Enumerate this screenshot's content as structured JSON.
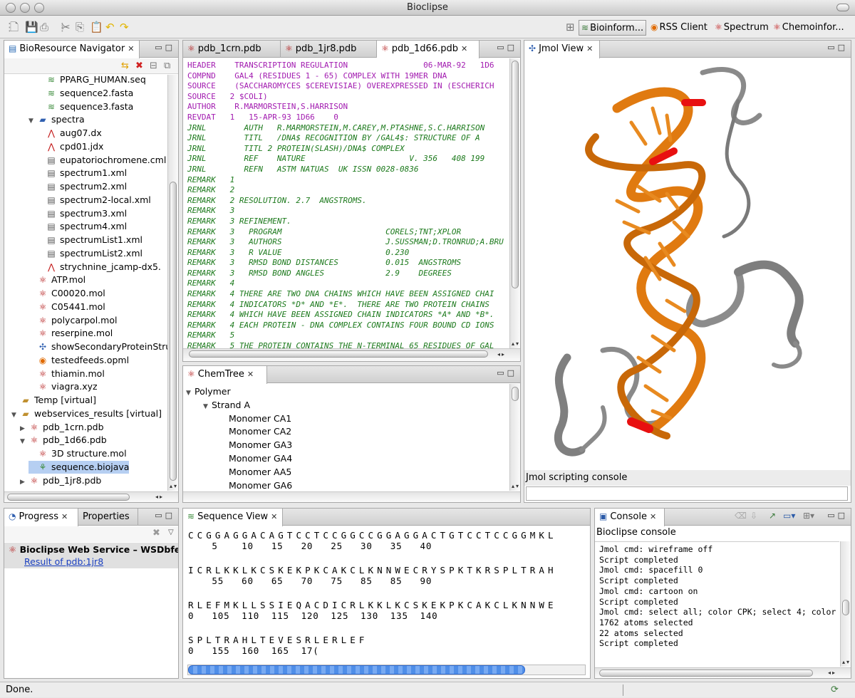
{
  "window": {
    "title": "Bioclipse"
  },
  "perspectives": [
    {
      "label": "Bioinform...",
      "icon": "bioinformatics-icon",
      "active": true
    },
    {
      "label": "RSS Client",
      "icon": "rss-icon"
    },
    {
      "label": "Spectrum",
      "icon": "spectrum-icon"
    },
    {
      "label": "Chemoinfor...",
      "icon": "chemoinformatics-icon"
    }
  ],
  "navigator": {
    "title": "BioResource Navigator",
    "items": [
      {
        "label": "PPARG_HUMAN.seq",
        "indent": 4,
        "icon": "sequence-icon"
      },
      {
        "label": "sequence2.fasta",
        "indent": 4,
        "icon": "sequence-icon"
      },
      {
        "label": "sequence3.fasta",
        "indent": 4,
        "icon": "sequence-icon"
      },
      {
        "label": "spectra",
        "indent": 3,
        "icon": "folder-icon",
        "twisty": "open"
      },
      {
        "label": "aug07.dx",
        "indent": 4,
        "icon": "spectrum-file-icon"
      },
      {
        "label": "cpd01.jdx",
        "indent": 4,
        "icon": "spectrum-file-icon"
      },
      {
        "label": "eupatoriochromene.cml",
        "indent": 4,
        "icon": "cml-file-icon"
      },
      {
        "label": "spectrum1.xml",
        "indent": 4,
        "icon": "xml-file-icon"
      },
      {
        "label": "spectrum2.xml",
        "indent": 4,
        "icon": "xml-file-icon"
      },
      {
        "label": "spectrum2-local.xml",
        "indent": 4,
        "icon": "xml-file-icon"
      },
      {
        "label": "spectrum3.xml",
        "indent": 4,
        "icon": "xml-file-icon"
      },
      {
        "label": "spectrum4.xml",
        "indent": 4,
        "icon": "xml-file-icon"
      },
      {
        "label": "spectrumList1.xml",
        "indent": 4,
        "icon": "xml-file-icon"
      },
      {
        "label": "spectrumList2.xml",
        "indent": 4,
        "icon": "xml-file-icon"
      },
      {
        "label": "strychnine_jcamp-dx5.",
        "indent": 4,
        "icon": "spectrum-file-icon"
      },
      {
        "label": "ATP.mol",
        "indent": 3,
        "icon": "molecule-icon"
      },
      {
        "label": "C00020.mol",
        "indent": 3,
        "icon": "molecule-icon"
      },
      {
        "label": "C05441.mol",
        "indent": 3,
        "icon": "molecule-icon"
      },
      {
        "label": "polycarpol.mol",
        "indent": 3,
        "icon": "molecule-icon"
      },
      {
        "label": "reserpine.mol",
        "indent": 3,
        "icon": "molecule-icon"
      },
      {
        "label": "showSecondaryProteinStruct",
        "indent": 3,
        "icon": "script-icon"
      },
      {
        "label": "testedfeeds.opml",
        "indent": 3,
        "icon": "feed-icon"
      },
      {
        "label": "thiamin.mol",
        "indent": 3,
        "icon": "molecule-icon"
      },
      {
        "label": "viagra.xyz",
        "indent": 3,
        "icon": "molecule-icon"
      },
      {
        "label": "Temp [virtual]",
        "indent": 1,
        "icon": "virtual-folder-icon"
      },
      {
        "label": "webservices_results [virtual]",
        "indent": 1,
        "icon": "virtual-folder-icon",
        "twisty": "open"
      },
      {
        "label": "pdb_1crn.pdb",
        "indent": 2,
        "icon": "pdb-icon",
        "twisty": "closed"
      },
      {
        "label": "pdb_1d66.pdb",
        "indent": 2,
        "icon": "pdb-icon",
        "twisty": "open"
      },
      {
        "label": "3D structure.mol",
        "indent": 3,
        "icon": "molecule-icon"
      },
      {
        "label": "sequence.biojava",
        "indent": 3,
        "icon": "biojava-icon",
        "selected": true
      },
      {
        "label": "pdb_1jr8.pdb",
        "indent": 2,
        "icon": "pdb-icon",
        "twisty": "closed"
      }
    ]
  },
  "editor": {
    "tabs": [
      {
        "label": "pdb_1crn.pdb"
      },
      {
        "label": "pdb_1jr8.pdb"
      },
      {
        "label": "pdb_1d66.pdb",
        "active": true
      }
    ],
    "lines": [
      {
        "t": "HEADER    TRANSCRIPTION REGULATION                06-MAR-92   1D6",
        "c": "mag"
      },
      {
        "t": "COMPND    GAL4 (RESIDUES 1 - 65) COMPLEX WITH 19MER DNA",
        "c": "mag"
      },
      {
        "t": "SOURCE    (SACCHAROMYCES $CEREVISIAE) OVEREXPRESSED IN (ESCHERICH",
        "c": "mag"
      },
      {
        "t": "SOURCE   2 $COLI)",
        "c": "mag"
      },
      {
        "t": "AUTHOR    R.MARMORSTEIN,S.HARRISON",
        "c": "mag"
      },
      {
        "t": "REVDAT   1   15-APR-93 1D66    0",
        "c": "mag"
      },
      {
        "t": "JRNL        AUTH   R.MARMORSTEIN,M.CAREY,M.PTASHNE,S.C.HARRISON",
        "c": "grn"
      },
      {
        "t": "JRNL        TITL   /DNA$ RECOGNITION BY /GAL4$: STRUCTURE OF A",
        "c": "grn"
      },
      {
        "t": "JRNL        TITL 2 PROTEIN(SLASH)/DNA$ COMPLEX",
        "c": "grn"
      },
      {
        "t": "JRNL        REF    NATURE                      V. 356   408 199",
        "c": "grn"
      },
      {
        "t": "JRNL        REFN   ASTM NATUAS  UK ISSN 0028-0836",
        "c": "grn"
      },
      {
        "t": "REMARK   1",
        "c": "grn"
      },
      {
        "t": "REMARK   2",
        "c": "grn"
      },
      {
        "t": "REMARK   2 RESOLUTION. 2.7  ANGSTROMS.",
        "c": "grn"
      },
      {
        "t": "REMARK   3",
        "c": "grn"
      },
      {
        "t": "REMARK   3 REFINEMENT.",
        "c": "grn"
      },
      {
        "t": "REMARK   3   PROGRAM                      CORELS;TNT;XPLOR",
        "c": "grn"
      },
      {
        "t": "REMARK   3   AUTHORS                      J.SUSSMAN;D.TRONRUD;A.BRU",
        "c": "grn"
      },
      {
        "t": "REMARK   3   R VALUE                      0.230",
        "c": "grn"
      },
      {
        "t": "REMARK   3   RMSD BOND DISTANCES          0.015  ANGSTROMS",
        "c": "grn"
      },
      {
        "t": "REMARK   3   RMSD BOND ANGLES             2.9    DEGREES",
        "c": "grn"
      },
      {
        "t": "REMARK   4",
        "c": "grn"
      },
      {
        "t": "REMARK   4 THERE ARE TWO DNA CHAINS WHICH HAVE BEEN ASSIGNED CHAI",
        "c": "grn"
      },
      {
        "t": "REMARK   4 INDICATORS *D* AND *E*.  THERE ARE TWO PROTEIN CHAINS",
        "c": "grn"
      },
      {
        "t": "REMARK   4 WHICH HAVE BEEN ASSIGNED CHAIN INDICATORS *A* AND *B*.",
        "c": "grn"
      },
      {
        "t": "REMARK   4 EACH PROTEIN - DNA COMPLEX CONTAINS FOUR BOUND CD IONS",
        "c": "grn"
      },
      {
        "t": "REMARK   5",
        "c": "grn"
      },
      {
        "t": "REMARK   5 THE PROTEIN CONTAINS THE N-TERMINAL 65 RESIDUES OF GAL",
        "c": "grn"
      }
    ]
  },
  "chemtree": {
    "title": "ChemTree",
    "items": [
      {
        "label": "Polymer",
        "indent": 0,
        "twisty": "open"
      },
      {
        "label": "Strand A",
        "indent": 1,
        "twisty": "open"
      },
      {
        "label": "Monomer CA1",
        "indent": 2
      },
      {
        "label": "Monomer CA2",
        "indent": 2
      },
      {
        "label": "Monomer GA3",
        "indent": 2
      },
      {
        "label": "Monomer GA4",
        "indent": 2
      },
      {
        "label": "Monomer AA5",
        "indent": 2
      },
      {
        "label": "Monomer GA6",
        "indent": 2
      }
    ]
  },
  "jmol": {
    "title": "Jmol View",
    "console_label": "Jmol scripting console",
    "console_input": ""
  },
  "progress": {
    "tabs": [
      {
        "label": "Progress",
        "active": true
      },
      {
        "label": "Properties"
      }
    ],
    "job": "Bioclipse Web Service – WSDbfetch",
    "result_link": "Result of pdb:1jr8",
    "progress_fraction": 0.85
  },
  "sequence": {
    "title": "Sequence View",
    "rows": [
      {
        "seq": "CCGGAGGACAGTCCTCCGGCCGGAGGACTGTCCTCCGGMKL",
        "nums": "    5    10   15   20   25   30   35   40"
      },
      {
        "seq": "ICRLKKLKCSKEKPKCAKCLKNNWECRYSPKTKRSPLTRAH",
        "nums": "    55   60   65   70   75   85   85   90"
      },
      {
        "seq": "RLEFMKLLSSIEQACDICRLKKLKCSKEKPKCAKCLKNNWE",
        "nums": "0   105  110  115  120  125  130  135  140"
      },
      {
        "seq": "SPLTRAHLTEVESRLERLEF",
        "nums": "0   155  160  165  17("
      }
    ]
  },
  "console": {
    "title": "Console",
    "subtitle": "Bioclipse console",
    "lines": [
      "Jmol cmd: wireframe off",
      "Script completed",
      "Jmol cmd: spacefill 0",
      "Script completed",
      "Jmol cmd: cartoon on",
      "Script completed",
      "Jmol cmd: select all; color CPK; select 4; color",
      "1762 atoms selected",
      "22 atoms selected",
      "Script completed"
    ]
  },
  "status": {
    "text": "Done."
  },
  "colors": {
    "dna": "#e07a10",
    "protein": "#7a7a7a",
    "highlight": "#e81010",
    "selection": "#b6cff2"
  }
}
